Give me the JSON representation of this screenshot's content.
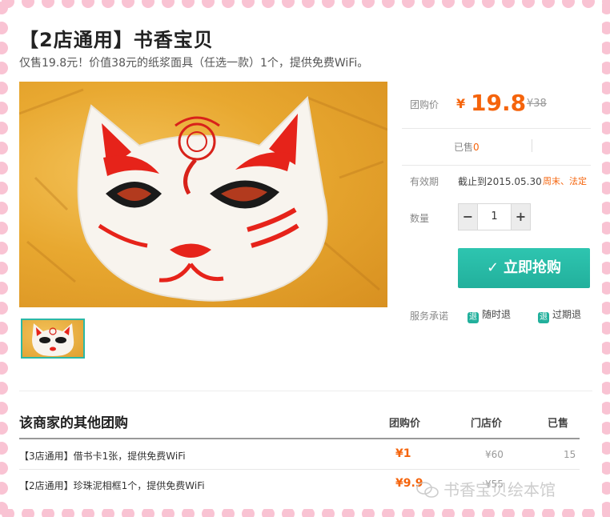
{
  "product": {
    "title": "【2店通用】书香宝贝",
    "subtitle": "仅售19.8元！价值38元的纸浆面具（任选一款）1个，提供免费WiFi。"
  },
  "pricing": {
    "label": "团购价",
    "currency": "¥",
    "price": "19.8",
    "original_price": "¥38",
    "accent_color": "#f5640c"
  },
  "sales": {
    "label": "已售",
    "count": "0"
  },
  "validity": {
    "label": "有效期",
    "text": "截止到2015.05.30",
    "highlight": "周末、法定"
  },
  "quantity": {
    "label": "数量",
    "minus": "−",
    "plus": "+",
    "value": "1"
  },
  "buy_button": {
    "check": "✓",
    "label": "立即抢购",
    "color": "#22b09c"
  },
  "service": {
    "label": "服务承诺",
    "items": [
      {
        "icon": "退",
        "icon_name": "refund-anytime-icon",
        "label": "随时退"
      },
      {
        "icon": "退",
        "icon_name": "refund-expired-icon",
        "label": "过期退"
      }
    ]
  },
  "other_deals": {
    "title": "该商家的其他团购",
    "headers": {
      "price": "团购价",
      "store_price": "门店价",
      "sold": "已售"
    },
    "rows": [
      {
        "name": "【3店通用】借书卡1张，提供免费WiFi",
        "price": "¥1",
        "store_price": "¥60",
        "sold": "15"
      },
      {
        "name": "【2店通用】珍珠泥相框1个，提供免费WiFi",
        "price": "¥9.9",
        "store_price": "¥55",
        "sold": ""
      }
    ]
  },
  "watermark": {
    "text": "书香宝贝绘本馆"
  }
}
